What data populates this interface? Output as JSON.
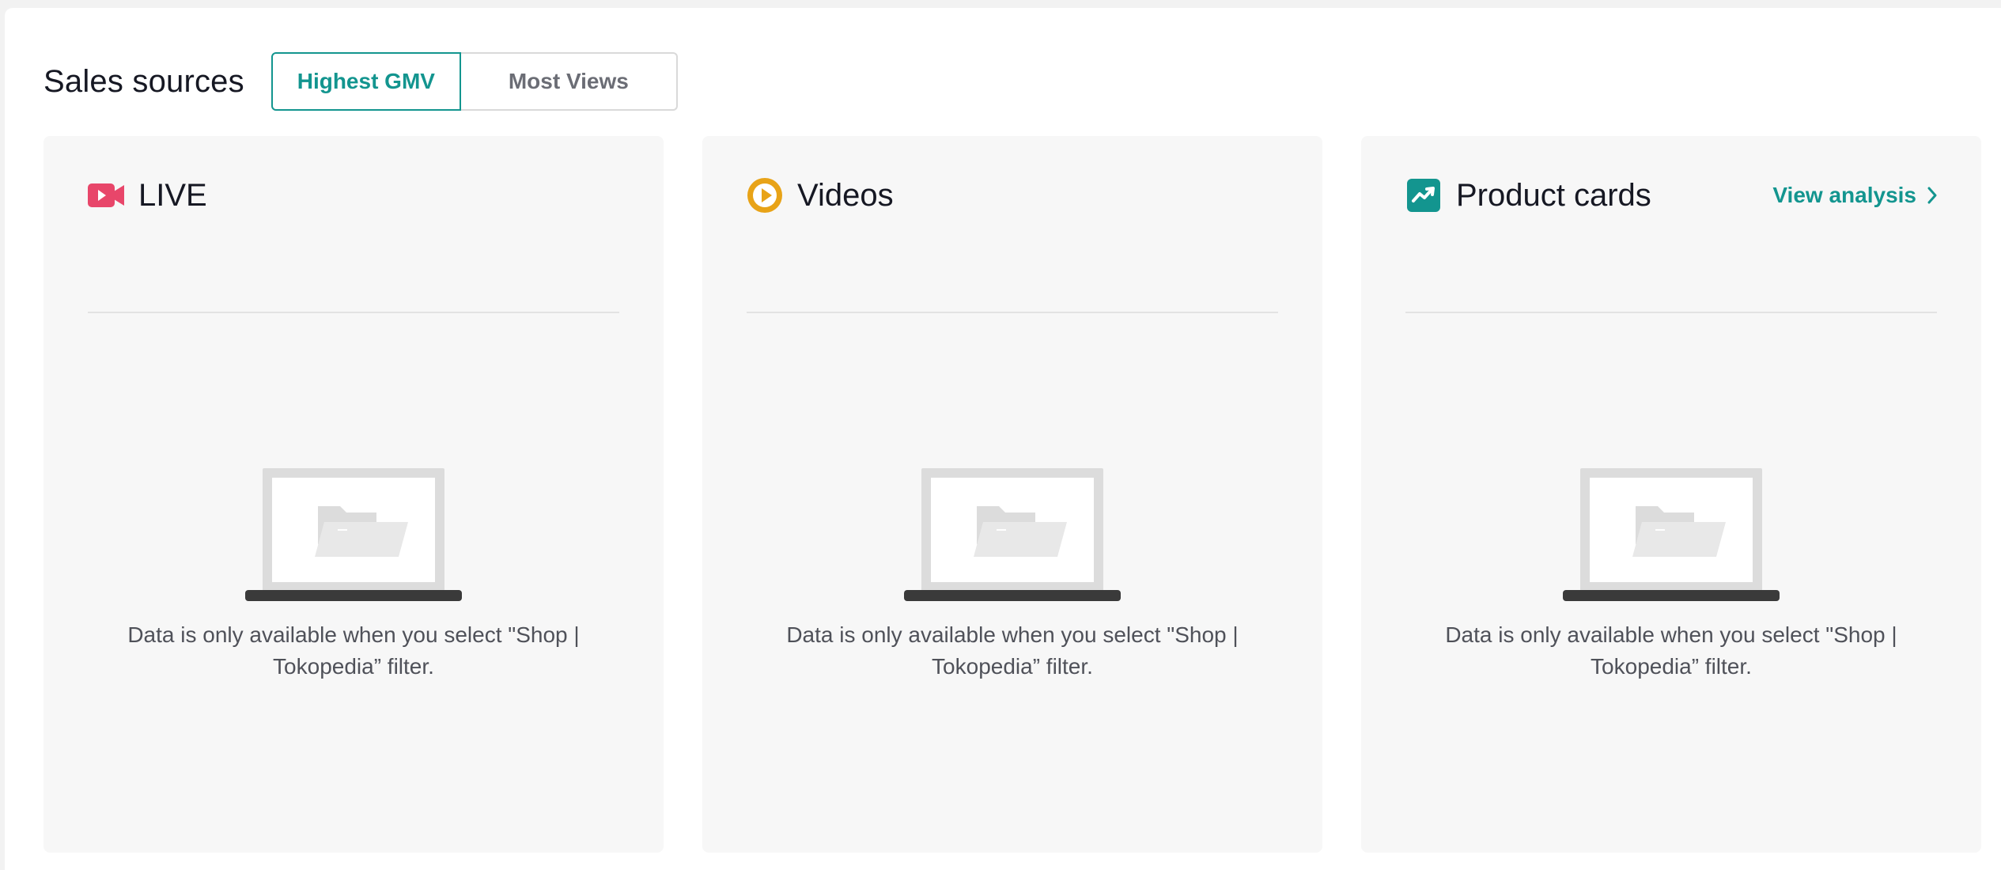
{
  "header": {
    "title": "Sales sources",
    "tabs": [
      {
        "label": "Highest GMV",
        "active": true
      },
      {
        "label": "Most Views",
        "active": false
      }
    ]
  },
  "cards": [
    {
      "title": "LIVE",
      "icon": "live-video-icon",
      "icon_color": "#e8466a"
    },
    {
      "title": "Videos",
      "icon": "play-circle-icon",
      "icon_color": "#e8a317"
    },
    {
      "title": "Product cards",
      "icon": "trend-chart-icon",
      "icon_color": "#13958f",
      "link_label": "View analysis"
    }
  ],
  "empty_message": "Data is only available when you select \"Shop | Tokopedia” filter.",
  "colors": {
    "accent": "#13958f",
    "card_bg": "#f7f7f7",
    "text_primary": "#161823",
    "text_secondary": "#4f5159"
  }
}
